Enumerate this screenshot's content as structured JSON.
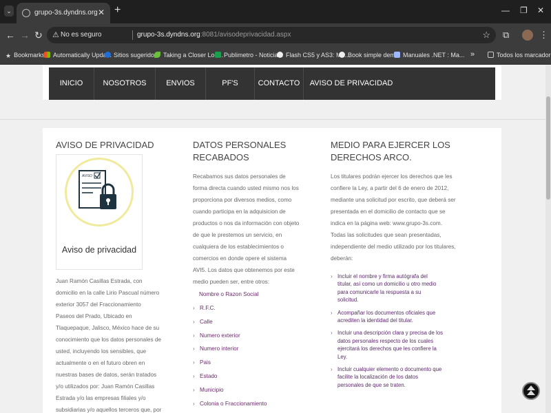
{
  "browser": {
    "tab_title": "grupo-3s.dyndns.org:8081/aviso",
    "tab_menu_glyph": "⌄",
    "new_tab_glyph": "+",
    "close_tab_glyph": "✕",
    "minimize_glyph": "—",
    "restore_glyph": "❐",
    "close_window_glyph": "✕",
    "not_secure": "No es seguro",
    "url_host": "grupo-3s.dyndns.org",
    "url_path": ":8081/avisodeprivacidad.aspx",
    "menu_glyph": "⋮",
    "bookmarks": [
      {
        "label": "Bookmarks",
        "icon": "star-icon",
        "color": "#d8d8d8"
      },
      {
        "label": "Automatically Upda...",
        "icon": "windows-icon",
        "color": "#f25022"
      },
      {
        "label": "Sitios sugeridos",
        "icon": "ie-icon",
        "color": "#1e6fd9"
      },
      {
        "label": "Taking a Closer Loo...",
        "icon": "leaf-icon",
        "color": "#6cbf3c"
      },
      {
        "label": "Publimetro - Noticia...",
        "icon": "publimetro-icon",
        "color": "#1aa04a"
      },
      {
        "label": "Flash CS5 y AS3: Mu...",
        "icon": "bubble-icon",
        "color": "#eeeeee"
      },
      {
        "label": "Book simple demo",
        "icon": "globe-icon",
        "color": "#eeeeee"
      },
      {
        "label": "Manuales .NET : Ma...",
        "icon": "page-icon",
        "color": "#a0b8ff"
      }
    ],
    "bookmarks_overflow": "»",
    "all_bookmarks": "Todos los marcadores"
  },
  "nav": {
    "items": [
      "INICIO",
      "NOSOTROS",
      "ENVIOS",
      "PF'S",
      "CONTACTO",
      "AVISO DE PRIVACIDAD"
    ],
    "bg_color": "#333333"
  },
  "col1": {
    "title": "AVISO DE PRIVACIDAD",
    "logo_doc_text": "AVISO",
    "logo_caption": "Aviso de privacidad",
    "lines": [
      "Juan Ramón Casillas Estrada, con",
      "domicilio en la calle Lirio Pascual número",
      "exterior 3057 del Fraccionamiento",
      "Paseos del Prado, Ubicado en",
      "Tlaquepaque, Jalisco, México hace de su",
      "conocimiento que los datos personales de",
      "usted, incluyendo los sensibles, que",
      "actualmente o en el futuro obren en",
      "nuestras bases de datos, serán tratados",
      "y/o utilizados por: Juan Ramón Casillas",
      "Estrada y/o las empresas filiales y/o",
      "subsidiarias y/o aquellos terceros que, por"
    ]
  },
  "col2": {
    "title_line1": "DATOS PERSONALES",
    "title_line2": "RECABADOS",
    "lines": [
      "Recabamos sus datos personales de",
      "forma directa cuando usted mismo nos los",
      "proporciona por diversos medios, como",
      "cuando participa en la adquisicion de",
      "productos o nos da información con objeto",
      "de que le prestemos un servicio, en",
      "cualquiera de los establecimientos o",
      "comercios en donde opere el sistema",
      "AVI5. Los datos que obtenemos por este",
      "medio pueden ser, entre otros:"
    ],
    "first_item": "Nombre o Razon Social",
    "items": [
      "R.F.C.",
      "Calle",
      "Numero exterior",
      "Numero interior",
      "Pais",
      "Estado",
      "Municipio",
      "Colonia o Fraccionamiento"
    ]
  },
  "col3": {
    "title_line1": "MEDIO PARA EJERCER LOS",
    "title_line2": "DERECHOS ARCO.",
    "lines": [
      "Los titulares podrán ejercer los derechos que les",
      "confiere la Ley, a partir del 6 de enero de 2012,",
      "mediante una solicitud por escrito, que deberá ser",
      "presentada en el domicilio de contacto que se",
      "indica en la página web: www.grupo-3s.com.",
      "Todas las solicitudes que sean presentadas,",
      "independiente del medio utilizado por los titulares,",
      "deberán:"
    ],
    "items": [
      [
        "Incluir el nombre y firma autógrafa del",
        "titular, así como un domicilio u otro medio",
        "para comunicarle la respuesta a su",
        "solicitud."
      ],
      [
        "Acompañar los documentos oficiales que",
        "acrediten la identidad del titular."
      ],
      [
        "Incluir una descripción clara y precisa de los",
        "datos personales respecto de los cuales",
        "ejercitará los derechos que les confiere la",
        "Ley."
      ],
      [
        "Incluir cualquier elemento o documento que",
        "facilite la localización de los datos",
        "personales de que se traten."
      ]
    ]
  }
}
